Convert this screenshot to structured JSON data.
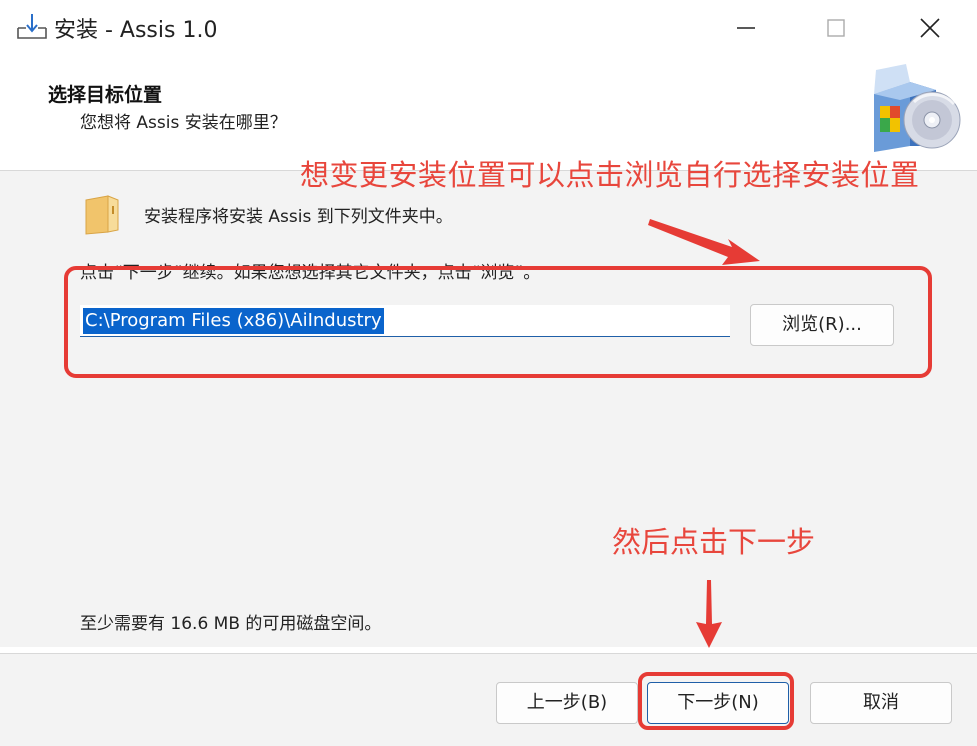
{
  "window": {
    "title": "安装 - Assis 1.0"
  },
  "header": {
    "title": "选择目标位置",
    "subtitle": "您想将 Assis 安装在哪里？"
  },
  "body": {
    "info": "安装程序将安装 Assis 到下列文件夹中。",
    "hint": "点击“下一步”继续。如果您想选择其它文件夹，点击“浏览”。",
    "path_value": "C:\\Program Files (x86)\\AiIndustry",
    "browse_label": "浏览(R)...",
    "disk_space": "至少需要有 16.6 MB 的可用磁盘空间。"
  },
  "annotations": {
    "top": "想变更安装位置可以点击浏览自行选择安装位置",
    "bottom": "然后点击下一步",
    "color": "#e63b35"
  },
  "footer": {
    "back_label": "上一步(B)",
    "next_label": "下一步(N)",
    "cancel_label": "取消"
  },
  "icons": {
    "app": "install-icon",
    "minimize": "minimize-icon",
    "maximize": "maximize-icon",
    "close": "close-icon",
    "header_art": "setup-box-disc-icon",
    "folder": "folder-icon"
  }
}
